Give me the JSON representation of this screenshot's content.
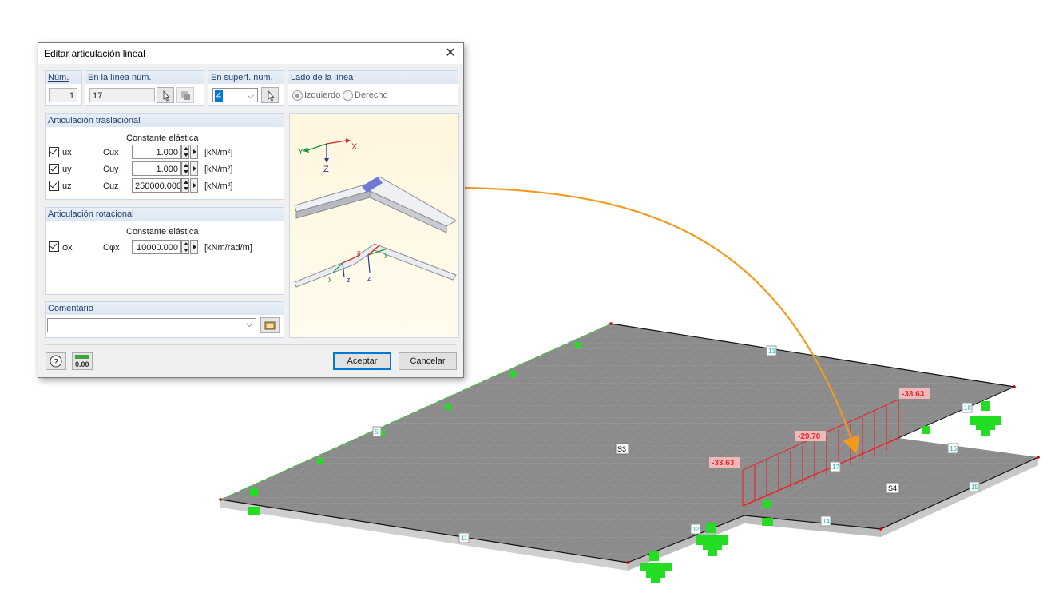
{
  "dialog": {
    "title": "Editar articulación lineal",
    "num": {
      "label": "Núm.",
      "value": "1"
    },
    "line": {
      "label": "En la línea núm.",
      "value": "17"
    },
    "surface": {
      "label": "En superf. núm.",
      "value": "4"
    },
    "side": {
      "label": "Lado de la línea",
      "left": "Izquierdo",
      "right": "Derecho"
    },
    "translational": {
      "title": "Articulación traslacional",
      "spring_header": "Constante elástica",
      "rows": [
        {
          "dof": "ux",
          "coef": "Cux",
          "value": "1.000",
          "unit": "[kN/m²]"
        },
        {
          "dof": "uy",
          "coef": "Cuy",
          "value": "1.000",
          "unit": "[kN/m²]"
        },
        {
          "dof": "uz",
          "coef": "Cuz",
          "value": "250000.000",
          "unit": "[kN/m²]"
        }
      ]
    },
    "rotational": {
      "title": "Articulación rotacional",
      "spring_header": "Constante elástica",
      "rows": [
        {
          "dof": "φx",
          "coef": "Cφx",
          "value": "10000.000",
          "unit": "[kNm/rad/m]"
        }
      ]
    },
    "comment": {
      "label": "Comentario",
      "value": ""
    },
    "footer": {
      "ok": "Aceptar",
      "cancel": "Cancelar",
      "units_icon_text": "0.00"
    },
    "colon": ":"
  },
  "illustration": {
    "axes": {
      "x": "X",
      "y": "Y",
      "z": "Z"
    },
    "local_axes": {
      "x": "x",
      "y": "y",
      "z": "z"
    }
  },
  "model": {
    "surfaces": [
      "S3",
      "S4"
    ],
    "line_labels": [
      "13",
      "5",
      "11",
      "12",
      "14",
      "15",
      "16",
      "17",
      "18"
    ],
    "values": [
      "-33.63",
      "-29.70",
      "-33.63"
    ],
    "colors": {
      "slab": "#8b8b8b",
      "support": "#22dd22",
      "diagram": "#e8272c",
      "arrow": "#f39a1e",
      "label": "#00b5c8"
    }
  }
}
